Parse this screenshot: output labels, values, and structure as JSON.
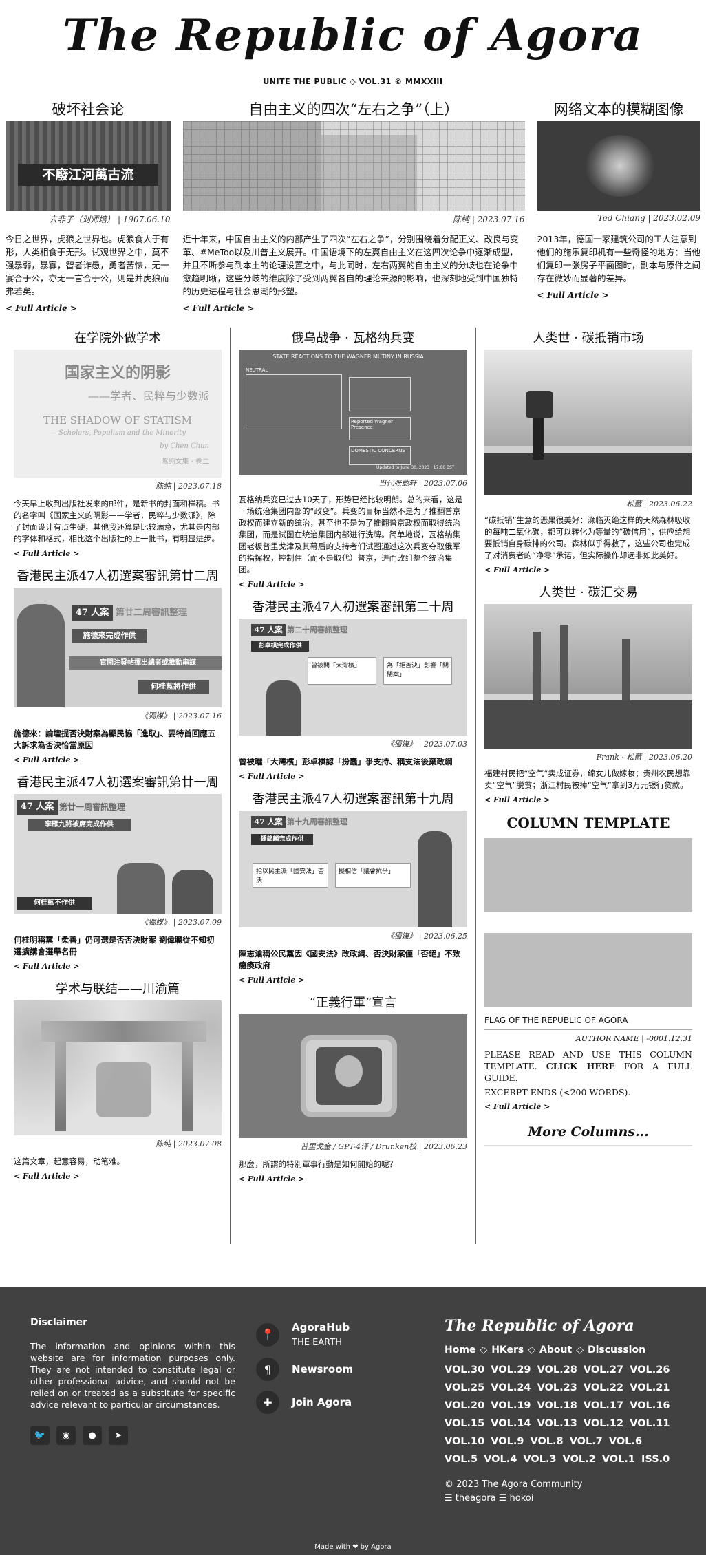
{
  "masthead": {
    "title": "The Republic of Agora",
    "tagline": "UNITE THE PUBLIC ◇ VOL.31 © MMXXIII"
  },
  "top": [
    {
      "title": "破坏社会论",
      "credit": "去非子（刘师培） | 1907.06.10",
      "banner_text": "不廢江河萬古流",
      "body": "今日之世界，虎狼之世界也。虎狼食人于有形，人类相食于无形。试观世界之中，莫不强暴弱，暴寡，智者诈愚，勇者苦怯，无一宴合于公，亦无一言合于公，则是并虎狼而弗若矣。",
      "full": "< Full Article >"
    },
    {
      "title": "自由主义的四次“左右之争”（上）",
      "credit": "陈纯 | 2023.07.16",
      "body": "近十年来，中国自由主义的内部产生了四次“左右之争”，分别围绕着分配正义、改良与变革、#MeToo以及川普主义展开。中国语境下的左翼自由主义在这四次论争中逐渐成型，并且不断参与到本土的论理设置之中，与此同时，左右两翼的自由主义的分歧也在论争中愈趋明晰，这些分歧的维度除了受到两翼各自的理论来源的影响，也深刻地受到中国独特的历史进程与社会思潮的形塑。",
      "full": "< Full Article >"
    },
    {
      "title": "网络文本的模糊图像",
      "credit": "Ted Chiang | 2023.02.09",
      "body": "2013年，德国一家建筑公司的工人注意到他们的施乐复印机有一些奇怪的地方：当他们复印一张房子平面图时，副本与原件之间存在微妙而显著的差异。",
      "full": "< Full Article >"
    }
  ],
  "grid": {
    "left": [
      {
        "title": "在学院外做学术",
        "cover_cn_title": "国家主义的阴影",
        "cover_cn_sub": "——学者、民粹与少数派",
        "cover_en_title": "THE SHADOW OF STATISM",
        "cover_en_sub": "— Scholars, Populism and the Minority",
        "cover_by": "by Chen Chun",
        "cover_series": "陈纯文集 · 卷二",
        "credit": "陈纯 | 2023.07.18",
        "body": "今天早上收到出版社发来的邮件，是新书的封面和样稿。书的名字叫《国家主义的阴影——学者，民粹与少数派》，除了封面设计有点生硬，其他我还算是比较满意，尤其是内部的字体和格式，相比这个出版社的上一批书，有明显进步。",
        "full": "< Full Article >"
      },
      {
        "title": "香港民主派47人初選案審訊第廿二周",
        "badge": "47 人案",
        "badge_sub": "第廿二周審訊整理",
        "strip1": "施德來完成作供",
        "strip2": "官開注發帖揮出總者或推動串謀",
        "strip3": "何桂藍將作供",
        "credit": "《獨媒》 | 2023.07.16",
        "body": "施德來：論壇提否決財案為顯民協「進取」、要特首回應五大訴求為否決恰當原因",
        "full": "< Full Article >"
      },
      {
        "title": "香港民主派47人初選案審訊第廿一周",
        "badge": "47 人案",
        "badge_sub": "第廿一周審訊整理",
        "strip1": "李雁九將被席完成作供",
        "strip2": "何桂藍不作供",
        "credit": "《獨媒》 | 2023.07.09",
        "body": "何桂明稱黨「柔善」仍可選是否否決財案 劉偉聰從不知初選擴講會選舉名冊",
        "full": "< Full Article >"
      },
      {
        "title": "学术与联结——川渝篇",
        "credit": "陈纯 | 2023.07.08",
        "body": "这篇文章，起意容易，动笔难。",
        "full": "< Full Article >"
      }
    ],
    "mid": [
      {
        "title": "俄乌战争 · 瓦格纳兵变",
        "map_title": "STATE REACTIONS TO THE WAGNER MUTINY IN RUSSIA",
        "map_legend1": "NEUTRAL",
        "map_legend2": "Reported Wagner Presence",
        "map_legend3": "DOMESTIC CONCERNS",
        "map_note": "Updated to June 30, 2023 · 17:00 BST",
        "credit": "当代张载轩 | 2023.07.06",
        "body": "瓦格纳兵变已过去10天了，形势已经比较明朗。总的来看，这是一场统治集团内部的“政变”。兵变的目标当然不是为了推翻普京政权而建立新的统治，甚至也不是为了推翻普京政权而取得统治集团，而是试图在统治集团内部进行洗牌。简单地说，瓦格纳集团老板普里戈津及其幕后的支持者们试图通过这次兵变夺取俄军的指挥权，控制住（而不是取代）普京，进而改组整个统治集团。",
        "full": "< Full Article >"
      },
      {
        "title": "香港民主派47人初選案審訊第二十周",
        "badge": "47 人案",
        "badge_sub": "第二十周審訊整理",
        "box1": "彭卓棋完成作供",
        "box2": "曾被問「大灣檳」",
        "box3": "為「拒否決」影響「關閉案」",
        "credit": "《獨媒》 | 2023.07.03",
        "body": "曾被曬「大灣檳」彭卓棋認「扮蠢」爭支持、稱支法後棄政綱",
        "full": "< Full Article >"
      },
      {
        "title": "香港民主派47人初選案審訊第十九周",
        "badge": "47 人案",
        "badge_sub": "第十九周審訊整理",
        "box1": "鍾錦麟完成作供",
        "box2": "指以民主派「國安法」否決",
        "box3": "擬相信「議會抗爭」",
        "credit": "《獨媒》 | 2023.06.25",
        "body": "陳志滄稱公民黨因《國安法》改政綱、否決財案僅「否絕」不致癱瘓政府",
        "full": "< Full Article >"
      },
      {
        "title": "“正義行軍”宣言",
        "credit": "普里戈金 / GPT-4译 / Drunken校 | 2023.06.23",
        "body": "那麼，所謂的特別軍事行動是如何開始的呢？",
        "full": "< Full Article >"
      }
    ],
    "right": [
      {
        "title": "人类世 · 碳抵销市场",
        "credit": "松藍 | 2023.06.22",
        "body": "“碳抵销”生意的恶果很美好：濒临灭绝这样的天然森林吸收的每吨二氧化碳，都可以转化为等量的“碳信用”，供应给想要抵销自身碳排的公司。森林似乎得救了，这些公司也完成了对消费者的“净零”承诺，但实际操作却远非如此美好。",
        "full": "< Full Article >"
      },
      {
        "title": "人类世 · 碳汇交易",
        "credit": "Frank · 松藍 | 2023.06.20",
        "body": "福建村民把“空气”卖成证券，绵女儿做嫁妆；贵州农民想靠卖“空气”脱贫；浙江村民被捧“空气”拿到3万元银行贷款。",
        "full": "< Full Article >"
      }
    ],
    "template": {
      "title": "COLUMN TEMPLATE",
      "caption": "FLAG OF THE REPUBLIC OF AGORA",
      "author": "AUTHOR NAME | -0001.12.31",
      "body1": "PLEASE READ AND USE THIS COLUMN TEMPLATE.",
      "click": "CLICK HERE",
      "body2": "FOR A FULL GUIDE.",
      "excerpt": "EXCERPT ENDS (<200 WORDS).",
      "full": "< Full Article >",
      "more": "More Columns..."
    }
  },
  "footer": {
    "disclaimer_title": "Disclaimer",
    "disclaimer": "The information and opinions within this website are for information purposes only. They are not intended to constitute legal or other professional advice, and should not be relied on or treated as a substitute for specific advice relevant to particular circumstances.",
    "links": [
      {
        "icon": "📍",
        "label": "AgoraHub",
        "sub": "THE EARTH"
      },
      {
        "icon": "¶",
        "label": "Newsroom",
        "sub": ""
      },
      {
        "icon": "✚",
        "label": "Join Agora",
        "sub": ""
      }
    ],
    "brand": "The Republic of Agora",
    "nav": [
      "Home",
      "HKers",
      "About",
      "Discussion"
    ],
    "vols": [
      "VOL.30",
      "VOL.29",
      "VOL.28",
      "VOL.27",
      "VOL.26",
      "VOL.25",
      "VOL.24",
      "VOL.23",
      "VOL.22",
      "VOL.21",
      "VOL.20",
      "VOL.19",
      "VOL.18",
      "VOL.17",
      "VOL.16",
      "VOL.15",
      "VOL.14",
      "VOL.13",
      "VOL.12",
      "VOL.11",
      "VOL.10",
      "VOL.9",
      "VOL.8",
      "VOL.7",
      "VOL.6",
      "VOL.5",
      "VOL.4",
      "VOL.3",
      "VOL.2",
      "VOL.1",
      "ISS.0"
    ],
    "copyright": "© 2023 The Agora Community",
    "handles": "☰ theagora ☰ hokoi",
    "made": "Made with ❤ by Agora"
  }
}
